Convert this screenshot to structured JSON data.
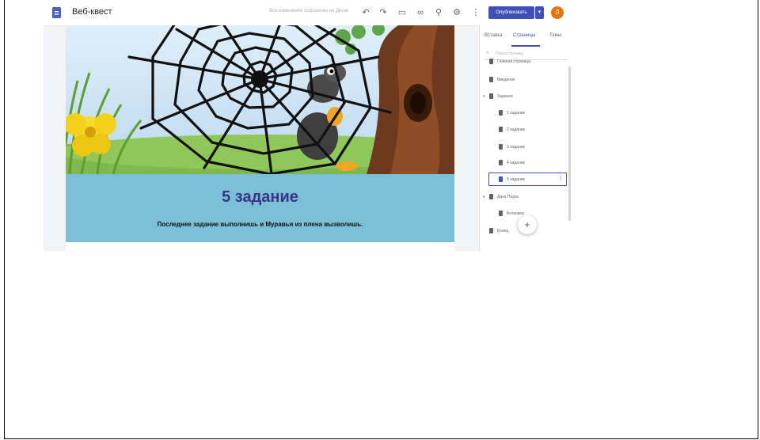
{
  "app": {
    "title": "Веб-квест",
    "hint": "Все изменения сохранены на Диске",
    "publish_label": "Опубликовать",
    "avatar_letter": "Л",
    "brand_color": "#3f51b5"
  },
  "toolbar": {
    "icons": [
      "undo-icon",
      "redo-icon",
      "preview-icon",
      "link-icon",
      "add-person-icon",
      "gear-icon",
      "more-vert-icon"
    ]
  },
  "page": {
    "heading": "5 задание",
    "subtext": "Последнее задание выполнишь и Муравья из плена вызволишь.",
    "band_color": "#7bbfd6"
  },
  "panel": {
    "tabs": [
      "Вставка",
      "Страницы",
      "Темы"
    ],
    "active_tab": "Страницы",
    "search_placeholder": "Поиск страниц",
    "items": [
      {
        "label": "Главная страница"
      },
      {
        "label": "Введение"
      },
      {
        "label": "Задание"
      },
      {
        "label": "1 задание"
      },
      {
        "label": "2 задание"
      },
      {
        "label": "3 задание"
      },
      {
        "label": "4 задание"
      },
      {
        "label": "5 задание"
      },
      {
        "label": "Дача Паука"
      },
      {
        "label": "Ботаника"
      },
      {
        "label": "Конец"
      }
    ],
    "selected_item": "5 задание"
  }
}
